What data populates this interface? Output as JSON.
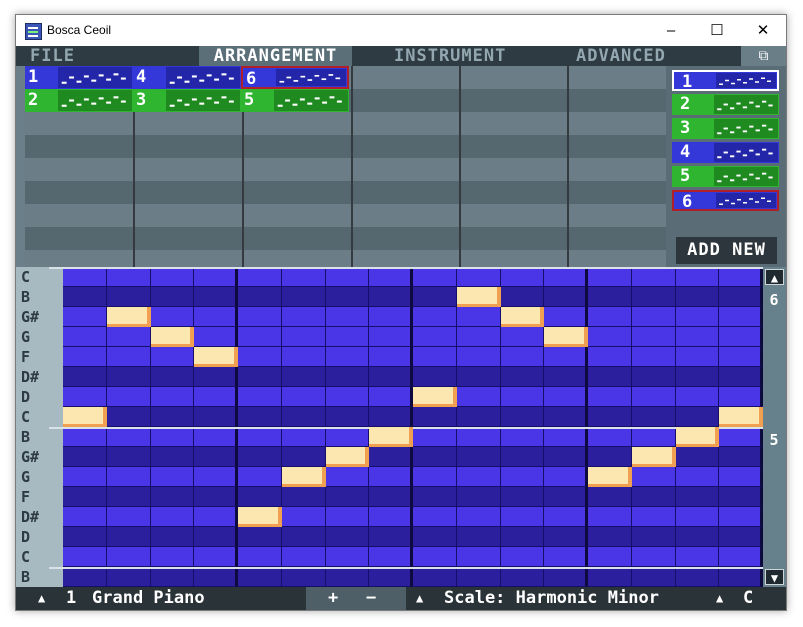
{
  "window": {
    "title": "Bosca Ceoil",
    "minimize": "–",
    "maximize": "☐",
    "close": "✕"
  },
  "menu": {
    "tabs": [
      {
        "label": "FILE",
        "active": false
      },
      {
        "label": "ARRANGEMENT",
        "active": true
      },
      {
        "label": "INSTRUMENT",
        "active": false
      },
      {
        "label": "ADVANCED",
        "active": false
      }
    ],
    "fullscreen_icon": "⧉"
  },
  "arrangement": {
    "patterns": [
      {
        "lane": 0,
        "bar": 0,
        "num": "1",
        "type": "blue"
      },
      {
        "lane": 0,
        "bar": 1,
        "num": "4",
        "type": "blue"
      },
      {
        "lane": 0,
        "bar": 2,
        "num": "6",
        "type": "blue",
        "selected": true
      },
      {
        "lane": 1,
        "bar": 0,
        "num": "2",
        "type": "green"
      },
      {
        "lane": 1,
        "bar": 1,
        "num": "3",
        "type": "green"
      },
      {
        "lane": 1,
        "bar": 2,
        "num": "5",
        "type": "green"
      }
    ]
  },
  "pattern_list": {
    "items": [
      {
        "num": "1",
        "type": "blue",
        "highlight": "white"
      },
      {
        "num": "2",
        "type": "green"
      },
      {
        "num": "3",
        "type": "green"
      },
      {
        "num": "4",
        "type": "blue"
      },
      {
        "num": "5",
        "type": "green"
      },
      {
        "num": "6",
        "type": "blue",
        "highlight": "red"
      }
    ],
    "add_new_label": "ADD NEW"
  },
  "piano_roll": {
    "key_labels": [
      "C",
      "B",
      "G#",
      "G",
      "F",
      "D#",
      "D",
      "C",
      "B",
      "G#",
      "G",
      "F",
      "D#",
      "D",
      "C",
      "B"
    ],
    "octave_labels": [
      {
        "text": "6",
        "row": 1
      },
      {
        "text": "5",
        "row": 8
      }
    ],
    "notes": [
      {
        "step": 0,
        "row": 7
      },
      {
        "step": 1,
        "row": 2
      },
      {
        "step": 2,
        "row": 3
      },
      {
        "step": 3,
        "row": 4
      },
      {
        "step": 4,
        "row": 12
      },
      {
        "step": 5,
        "row": 10
      },
      {
        "step": 6,
        "row": 9
      },
      {
        "step": 7,
        "row": 8
      },
      {
        "step": 8,
        "row": 6
      },
      {
        "step": 9,
        "row": 1
      },
      {
        "step": 10,
        "row": 2
      },
      {
        "step": 11,
        "row": 3
      },
      {
        "step": 12,
        "row": 10
      },
      {
        "step": 13,
        "row": 9
      },
      {
        "step": 14,
        "row": 8
      },
      {
        "step": 15,
        "row": 7
      }
    ],
    "scroll_up_icon": "▲",
    "scroll_down_icon": "▼"
  },
  "status_bar": {
    "instrument_arrow": "▲",
    "instrument_number": "1",
    "instrument_name": "Grand Piano",
    "plus": "+",
    "minus": "−",
    "scale_arrow": "▲",
    "scale_text": "Scale: Harmonic Minor",
    "key_arrow": "▲",
    "key_text": "C"
  },
  "colors": {
    "blue_pattern": "#3538d8",
    "green_pattern": "#2fb52f",
    "grid_light": "#4a36e6",
    "grid_dark": "#2b1f9d",
    "note": "#fde7b0",
    "note_shadow": "#f0a050"
  }
}
